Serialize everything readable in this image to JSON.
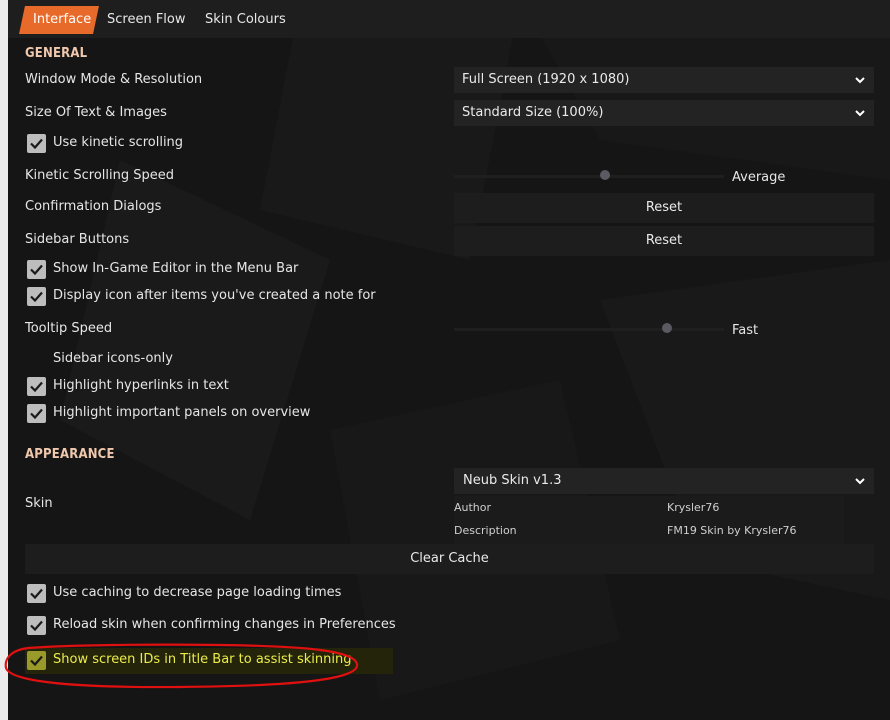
{
  "tabs": [
    {
      "label": "Interface",
      "active": true
    },
    {
      "label": "Screen Flow",
      "active": false
    },
    {
      "label": "Skin Colours",
      "active": false
    }
  ],
  "general": {
    "header": "GENERAL",
    "window_mode": {
      "label": "Window Mode & Resolution",
      "value": "Full Screen (1920 x 1080)"
    },
    "text_size": {
      "label": "Size Of Text & Images",
      "value": "Standard Size (100%)"
    },
    "kinetic_scrolling": {
      "label": "Use kinetic scrolling",
      "checked": true
    },
    "kinetic_speed": {
      "label": "Kinetic Scrolling Speed",
      "value_label": "Average",
      "level": 0.56
    },
    "confirmation_dialogs": {
      "label": "Confirmation Dialogs",
      "button": "Reset"
    },
    "sidebar_buttons": {
      "label": "Sidebar Buttons",
      "button": "Reset"
    },
    "ingame_editor": {
      "label": "Show In-Game Editor in the Menu Bar",
      "checked": true
    },
    "note_icon": {
      "label": "Display icon after items you've created a note for",
      "checked": true
    },
    "tooltip_speed": {
      "label": "Tooltip Speed",
      "value_label": "Fast",
      "level": 0.79
    },
    "sidebar_icons_only": {
      "label": "Sidebar icons-only",
      "checked": false
    },
    "highlight_hyperlinks": {
      "label": "Highlight hyperlinks in text",
      "checked": true
    },
    "highlight_panels": {
      "label": "Highlight important panels on overview",
      "checked": true
    }
  },
  "appearance": {
    "header": "APPEARANCE",
    "skin": {
      "label": "Skin",
      "value": "Neub Skin v1.3",
      "author_key": "Author",
      "author": "Krysler76",
      "description_key": "Description",
      "description": "FM19 Skin by Krysler76"
    },
    "clear_cache": "Clear Cache",
    "use_caching": {
      "label": "Use caching to decrease page loading times",
      "checked": true
    },
    "reload_skin": {
      "label": "Reload skin when confirming changes in Preferences",
      "checked": true
    },
    "show_screen_ids": {
      "label": "Show screen IDs in Title Bar to assist skinning",
      "checked": true
    }
  },
  "colors": {
    "accent": "#e76a2a",
    "section_header": "#f0c8ad",
    "highlight_text": "#ecec4a",
    "annotation": "#e01010"
  }
}
